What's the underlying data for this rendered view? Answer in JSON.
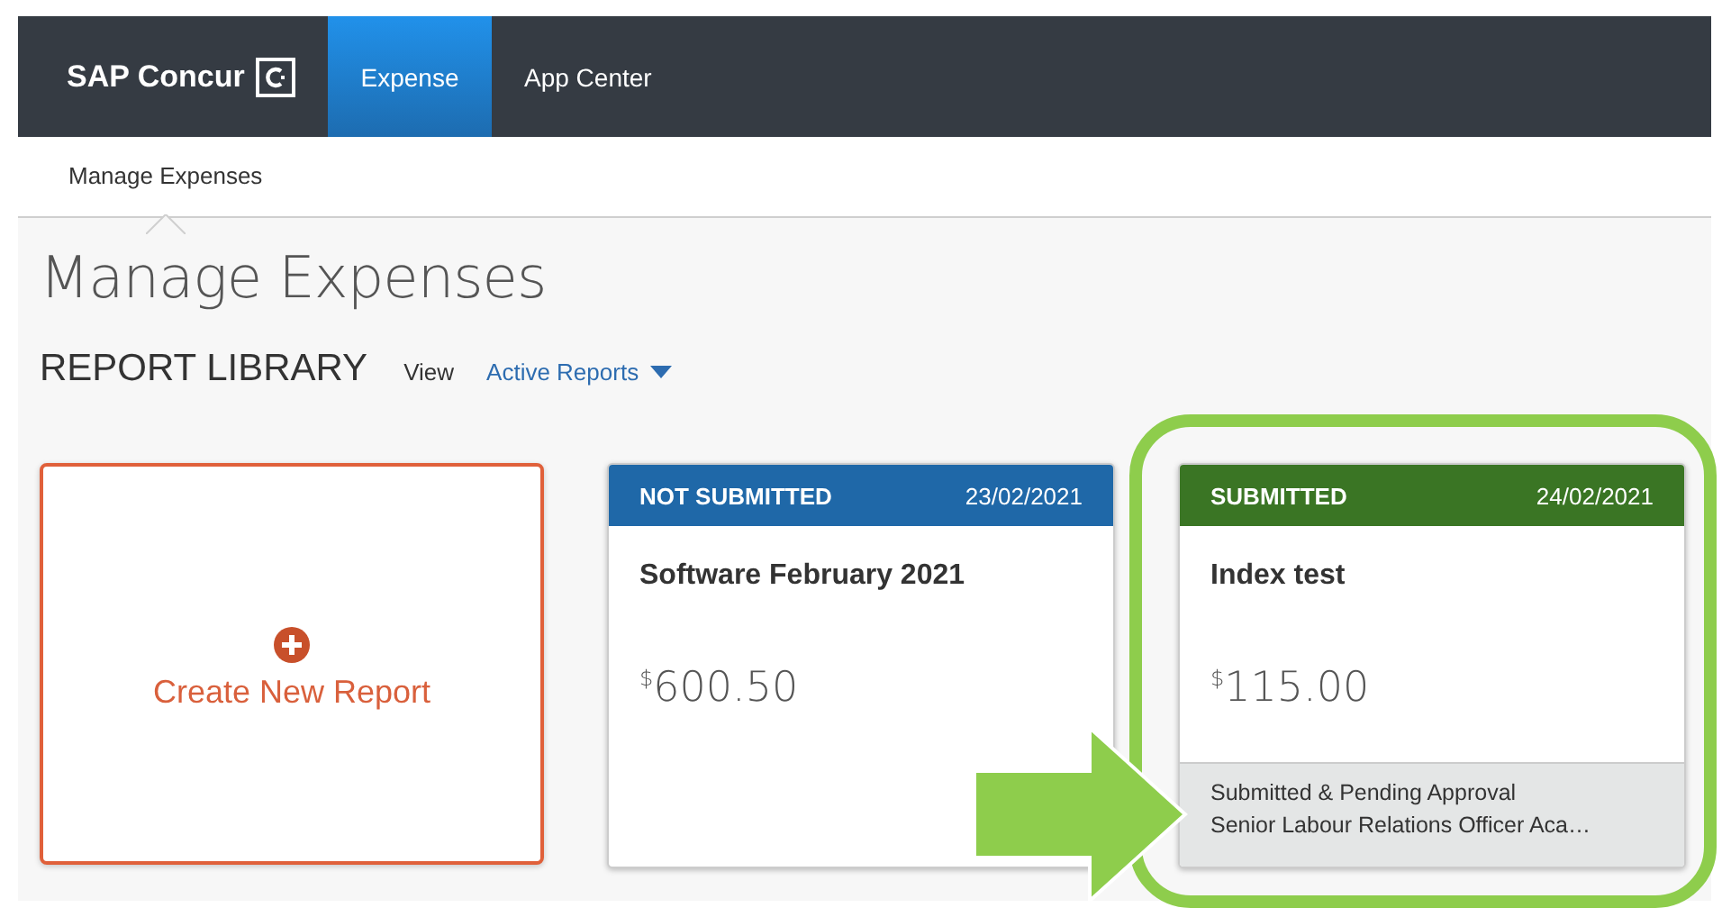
{
  "navbar": {
    "logo": "SAP Concur",
    "tabs": [
      {
        "label": "Expense",
        "selected": true
      },
      {
        "label": "App Center",
        "selected": false
      }
    ]
  },
  "subnav": {
    "items": [
      {
        "label": "Manage Expenses",
        "selected": true
      }
    ]
  },
  "page_title": "Manage Expenses",
  "library": {
    "heading": "REPORT LIBRARY",
    "view_label": "View",
    "filter": "Active Reports"
  },
  "cards": [
    {
      "kind": "create",
      "label": "Create New Report"
    },
    {
      "kind": "report",
      "status": "NOT SUBMITTED",
      "date": "23/02/2021",
      "color": "#1f68a8",
      "title": "Software February 2021",
      "currency": "$",
      "amount": "600.50",
      "highlighted": false
    },
    {
      "kind": "report",
      "status": "SUBMITTED",
      "date": "24/02/2021",
      "color": "#3a7524",
      "title": "Index test",
      "currency": "$",
      "amount": "115.00",
      "footer": [
        "Submitted & Pending Approval",
        "Senior Labour Relations Officer Aca…"
      ],
      "highlighted": true
    }
  ]
}
